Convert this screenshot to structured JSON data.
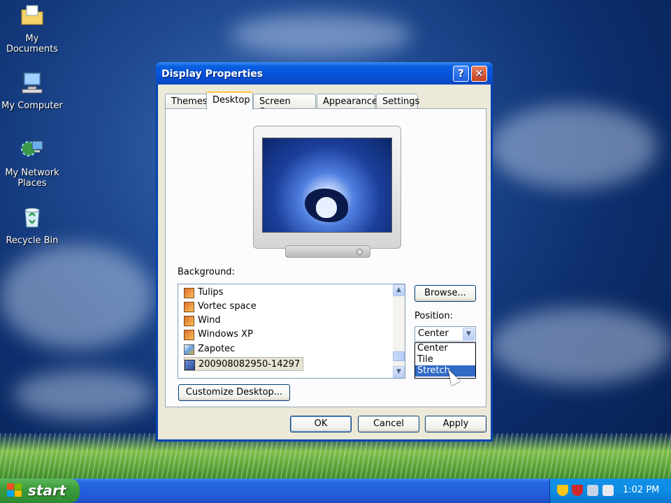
{
  "desktop_icons": [
    {
      "label": "My Documents"
    },
    {
      "label": "My Computer"
    },
    {
      "label": "My Network Places"
    },
    {
      "label": "Recycle Bin"
    }
  ],
  "dialog": {
    "title": "Display Properties",
    "help_glyph": "?",
    "close_glyph": "✕",
    "tabs": [
      "Themes",
      "Desktop",
      "Screen Saver",
      "Appearance",
      "Settings"
    ],
    "active_tab": "Desktop",
    "background_label": "Background:",
    "background_items": [
      {
        "label": "Tulips",
        "icon": "image-file-icon"
      },
      {
        "label": "Vortec space",
        "icon": "image-file-icon"
      },
      {
        "label": "Wind",
        "icon": "image-file-icon"
      },
      {
        "label": "Windows XP",
        "icon": "image-file-icon"
      },
      {
        "label": "Zapotec",
        "icon": "paint-brush-icon"
      },
      {
        "label": "200908082950-14297",
        "icon": "bitmap-file-icon",
        "selected": true
      }
    ],
    "browse_label": "Browse...",
    "position_label": "Position:",
    "position_value": "Center",
    "position_options": [
      "Center",
      "Tile",
      "Stretch"
    ],
    "highlighted_option": "Stretch",
    "customize_label": "Customize Desktop...",
    "ok_label": "OK",
    "cancel_label": "Cancel",
    "apply_label": "Apply"
  },
  "taskbar": {
    "start_label": "start",
    "clock": "1:02 PM"
  },
  "colors": {
    "titlebar": "#0550d8",
    "dialog_bg": "#ece9d8",
    "highlight": "#316ac5",
    "taskbar": "#245edb",
    "start_button": "#3c9c3c"
  }
}
